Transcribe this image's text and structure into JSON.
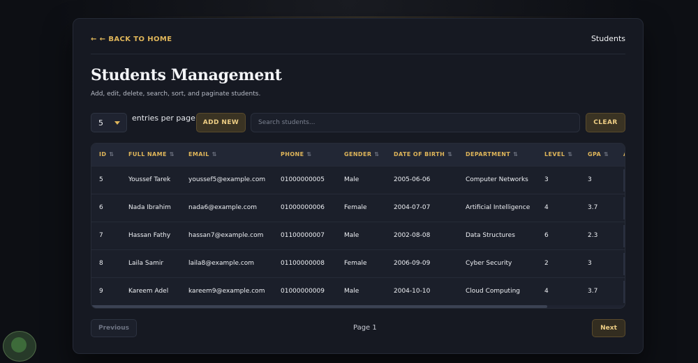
{
  "header": {
    "back_label": "← ← BACK TO HOME",
    "breadcrumb": "Students"
  },
  "page": {
    "title": "Students Management",
    "subtitle": "Add, edit, delete, search, sort, and paginate students."
  },
  "controls": {
    "per_page_value": "5",
    "per_page_label": "entries per page",
    "add_new_label": "ADD NEW",
    "search_placeholder": "Search students...",
    "clear_label": "CLEAR"
  },
  "table": {
    "columns": [
      "ID",
      "FULL NAME",
      "EMAIL",
      "PHONE",
      "GENDER",
      "DATE OF BIRTH",
      "DEPARTMENT",
      "LEVEL",
      "GPA",
      "A"
    ],
    "rows": [
      [
        "5",
        "Youssef Tarek",
        "youssef5@example.com",
        "01000000005",
        "Male",
        "2005-06-06",
        "Computer Networks",
        "3",
        "3"
      ],
      [
        "6",
        "Nada Ibrahim",
        "nada6@example.com",
        "01000000006",
        "Female",
        "2004-07-07",
        "Artificial Intelligence",
        "4",
        "3.7"
      ],
      [
        "7",
        "Hassan Fathy",
        "hassan7@example.com",
        "01100000007",
        "Male",
        "2002-08-08",
        "Data Structures",
        "6",
        "2.3"
      ],
      [
        "8",
        "Laila Samir",
        "laila8@example.com",
        "01100000008",
        "Female",
        "2006-09-09",
        "Cyber Security",
        "2",
        "3"
      ],
      [
        "9",
        "Kareem Adel",
        "kareem9@example.com",
        "01000000009",
        "Male",
        "2004-10-10",
        "Cloud Computing",
        "4",
        "3.7"
      ]
    ],
    "sort_icon": "sort-arrows-icon"
  },
  "pagination": {
    "previous_label": "Previous",
    "page_info": "Page 1",
    "next_label": "Next"
  },
  "colors": {
    "accent": "#e0b65a",
    "background": "#0d0f14",
    "card": "#161922"
  }
}
